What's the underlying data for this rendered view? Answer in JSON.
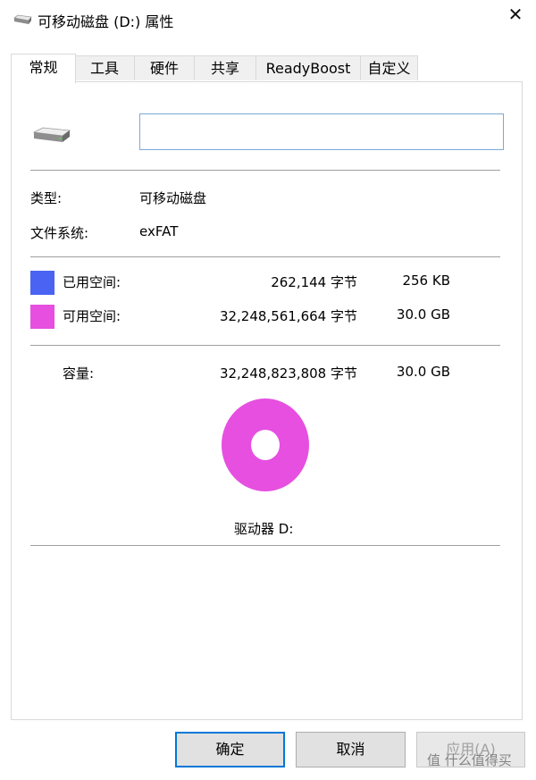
{
  "window": {
    "title": "可移动磁盘 (D:) 属性",
    "close_glyph": "✕"
  },
  "tabs": [
    {
      "label": "常规",
      "active": true
    },
    {
      "label": "工具",
      "active": false
    },
    {
      "label": "硬件",
      "active": false
    },
    {
      "label": "共享",
      "active": false
    },
    {
      "label": "ReadyBoost",
      "active": false
    },
    {
      "label": "自定义",
      "active": false
    }
  ],
  "general": {
    "name_value": "",
    "type_label": "类型:",
    "type_value": "可移动磁盘",
    "fs_label": "文件系统:",
    "fs_value": "exFAT",
    "used_label": "已用空间:",
    "used_bytes": "262,144 字节",
    "used_size": "256 KB",
    "free_label": "可用空间:",
    "free_bytes": "32,248,561,664 字节",
    "free_size": "30.0 GB",
    "capacity_label": "容量:",
    "capacity_bytes": "32,248,823,808 字节",
    "capacity_size": "30.0 GB",
    "drive_label": "驱动器 D:",
    "used_color": "#4a63f2",
    "free_color": "#e64fe0",
    "used_fraction": 8.1e-06
  },
  "buttons": {
    "ok": "确定",
    "cancel": "取消",
    "apply": "应用(A)"
  },
  "watermark": "值 什么值得买"
}
